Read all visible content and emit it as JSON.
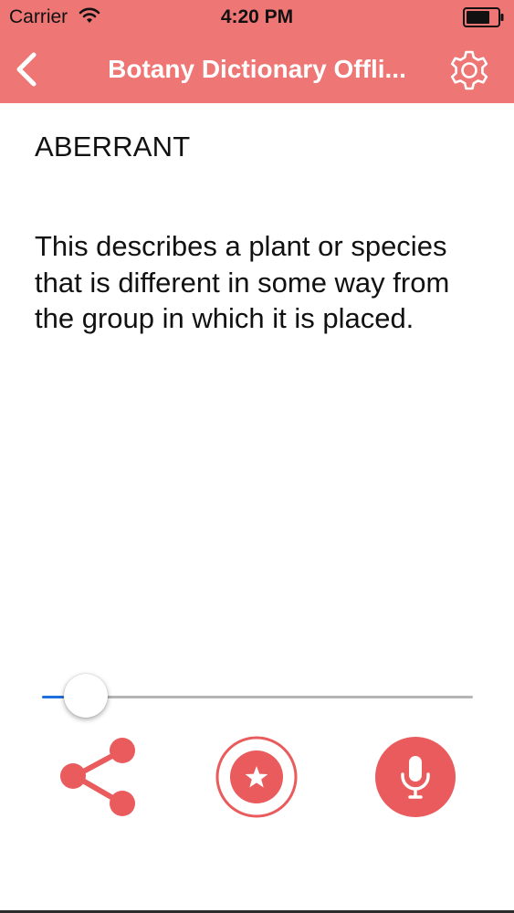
{
  "status_bar": {
    "carrier": "Carrier",
    "time": "4:20 PM",
    "wifi_icon": "wifi-icon",
    "battery_icon": "battery-icon"
  },
  "nav_bar": {
    "title": "Botany Dictionary Offli...",
    "back_icon": "chevron-left-icon",
    "settings_icon": "gear-icon",
    "background_color": "#ee7674"
  },
  "entry": {
    "term": "ABERRANT",
    "definition": "This describes a plant or species that is different in some way from the group in which it is placed."
  },
  "player": {
    "progress": 0.05,
    "track_color": "#b5b5b5",
    "fill_color": "#1f6fde"
  },
  "actions": {
    "share_icon": "share-icon",
    "favorite_icon": "star-icon",
    "voice_icon": "microphone-icon",
    "accent_color": "#e95b5c"
  }
}
